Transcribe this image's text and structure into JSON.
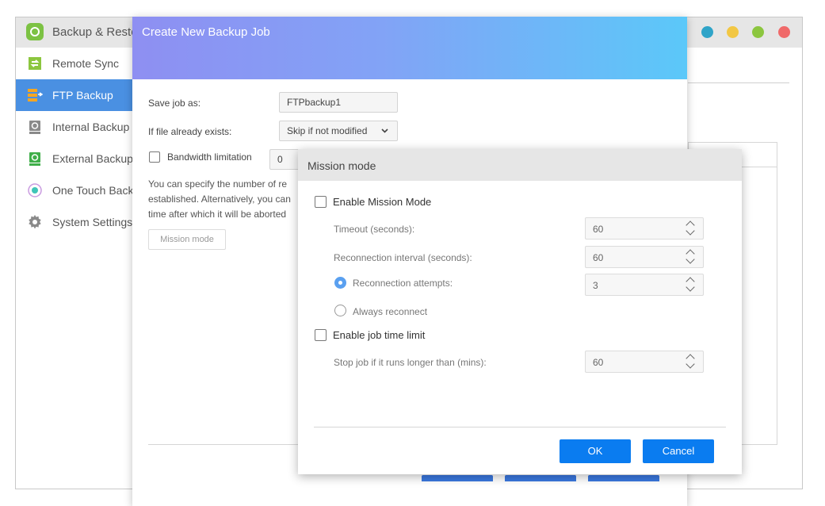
{
  "app": {
    "title": "Backup & Restore",
    "window_dots": [
      "#2fa4c8",
      "#f2c744",
      "#8cc63f",
      "#f06a6a"
    ]
  },
  "sidebar": {
    "items": [
      {
        "label": "Remote Sync",
        "icon": "sync-icon"
      },
      {
        "label": "FTP Backup",
        "icon": "ftp-server-icon"
      },
      {
        "label": "Internal Backup",
        "icon": "internal-drive-icon"
      },
      {
        "label": "External Backup",
        "icon": "external-drive-icon"
      },
      {
        "label": "One Touch Backup",
        "icon": "one-touch-icon"
      },
      {
        "label": "System Settings",
        "icon": "gear-icon"
      }
    ],
    "active_index": 1
  },
  "backup_dialog": {
    "title": "Create New Backup Job",
    "save_job_label": "Save job as:",
    "save_job_value": "FTPbackup1",
    "file_exists_label": "If file already exists:",
    "file_exists_value": "Skip if not modified",
    "bandwidth_label": "Bandwidth limitation",
    "bandwidth_value": "0",
    "description_lines": [
      "You can specify the number of re",
      "established. Alternatively, you can",
      "time after which it will be aborted"
    ],
    "mission_mode_button": "Mission mode"
  },
  "mission_dialog": {
    "title": "Mission mode",
    "enable_mission_label": "Enable Mission Mode",
    "timeout_label": "Timeout (seconds):",
    "timeout_value": "60",
    "reconnect_interval_label": "Reconnection interval (seconds):",
    "reconnect_interval_value": "60",
    "reconnect_attempts_label": "Reconnection attempts:",
    "reconnect_attempts_value": "3",
    "always_reconnect_label": "Always reconnect",
    "enable_time_limit_label": "Enable job time limit",
    "stop_job_label": "Stop job if it runs longer than (mins):",
    "stop_job_value": "60",
    "ok_label": "OK",
    "cancel_label": "Cancel"
  }
}
